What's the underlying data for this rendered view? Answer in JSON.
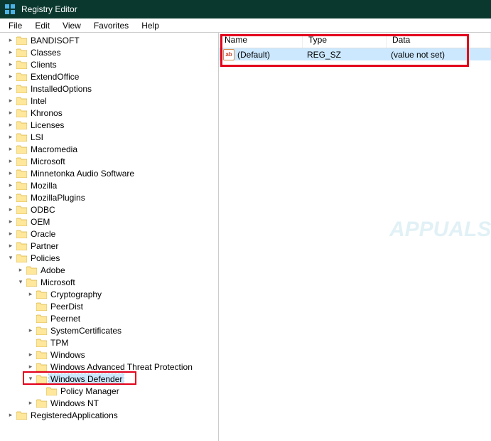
{
  "window": {
    "title": "Registry Editor"
  },
  "menu": {
    "items": [
      "File",
      "Edit",
      "View",
      "Favorites",
      "Help"
    ]
  },
  "tree": {
    "top": [
      {
        "label": "BANDISOFT",
        "exp": "closed"
      },
      {
        "label": "Classes",
        "exp": "closed"
      },
      {
        "label": "Clients",
        "exp": "closed"
      },
      {
        "label": "ExtendOffice",
        "exp": "closed"
      },
      {
        "label": "InstalledOptions",
        "exp": "closed"
      },
      {
        "label": "Intel",
        "exp": "closed"
      },
      {
        "label": "Khronos",
        "exp": "closed"
      },
      {
        "label": "Licenses",
        "exp": "closed"
      },
      {
        "label": "LSI",
        "exp": "closed"
      },
      {
        "label": "Macromedia",
        "exp": "closed"
      },
      {
        "label": "Microsoft",
        "exp": "closed"
      },
      {
        "label": "Minnetonka Audio Software",
        "exp": "closed"
      },
      {
        "label": "Mozilla",
        "exp": "closed"
      },
      {
        "label": "MozillaPlugins",
        "exp": "closed"
      },
      {
        "label": "ODBC",
        "exp": "closed"
      },
      {
        "label": "OEM",
        "exp": "closed"
      },
      {
        "label": "Oracle",
        "exp": "closed"
      },
      {
        "label": "Partner",
        "exp": "closed"
      }
    ],
    "policies_label": "Policies",
    "adobe_label": "Adobe",
    "microsoft_label": "Microsoft",
    "microsoft_children": [
      {
        "label": "Cryptography",
        "exp": "closed"
      },
      {
        "label": "PeerDist",
        "exp": "none"
      },
      {
        "label": "Peernet",
        "exp": "none"
      },
      {
        "label": "SystemCertificates",
        "exp": "closed"
      },
      {
        "label": "TPM",
        "exp": "none"
      },
      {
        "label": "Windows",
        "exp": "closed"
      },
      {
        "label": "Windows Advanced Threat Protection",
        "exp": "closed"
      }
    ],
    "defender_label": "Windows Defender",
    "policy_manager_label": "Policy Manager",
    "windows_nt_label": "Windows NT",
    "registered_apps_label": "RegisteredApplications"
  },
  "list": {
    "headers": {
      "name": "Name",
      "type": "Type",
      "data": "Data"
    },
    "row": {
      "icon": "ab",
      "name": "(Default)",
      "type": "REG_SZ",
      "data": "(value not set)"
    }
  },
  "watermark": "APPUALS"
}
